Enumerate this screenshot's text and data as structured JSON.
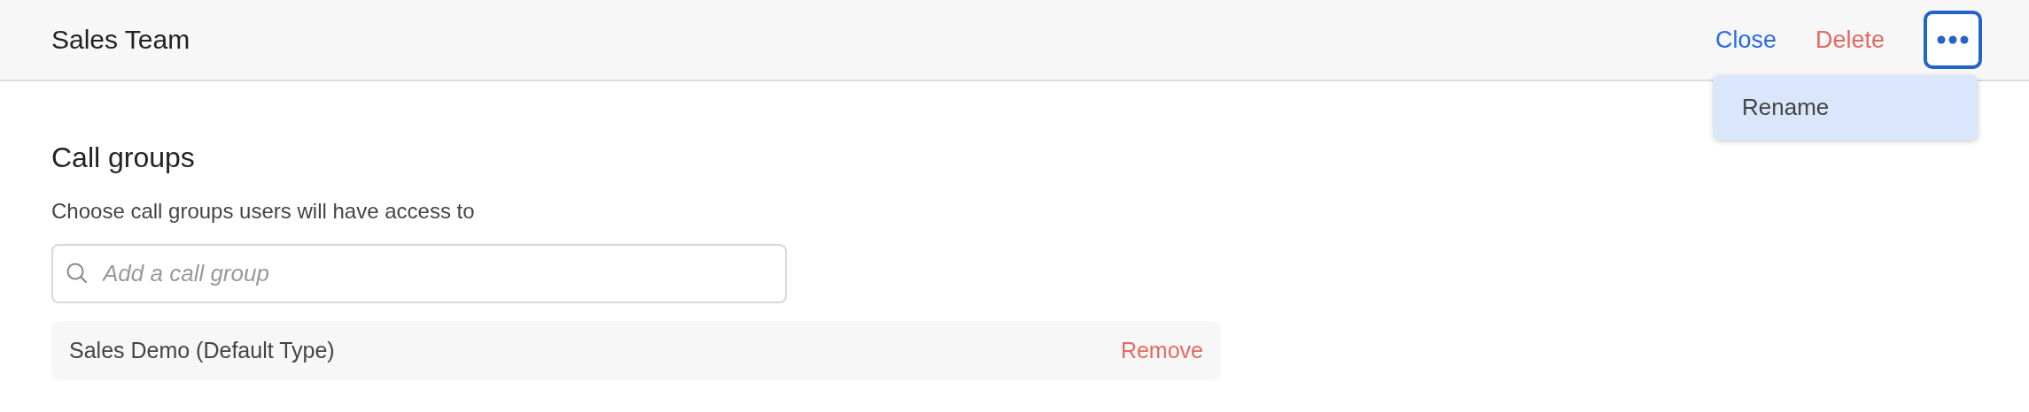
{
  "header": {
    "title": "Sales Team",
    "actions": [
      {
        "label": "Close",
        "kind": "primary"
      },
      {
        "label": "Delete",
        "kind": "danger"
      }
    ],
    "more_button": {
      "expanded": true
    },
    "menu": {
      "items": [
        {
          "label": "Rename",
          "selected": true
        }
      ]
    }
  },
  "section": {
    "title": "Call groups",
    "description": "Choose call groups users will have access to",
    "search": {
      "placeholder": "Add a call group"
    },
    "groups": [
      {
        "name": "Sales Demo (Default Type)",
        "action": "Remove"
      }
    ]
  }
}
